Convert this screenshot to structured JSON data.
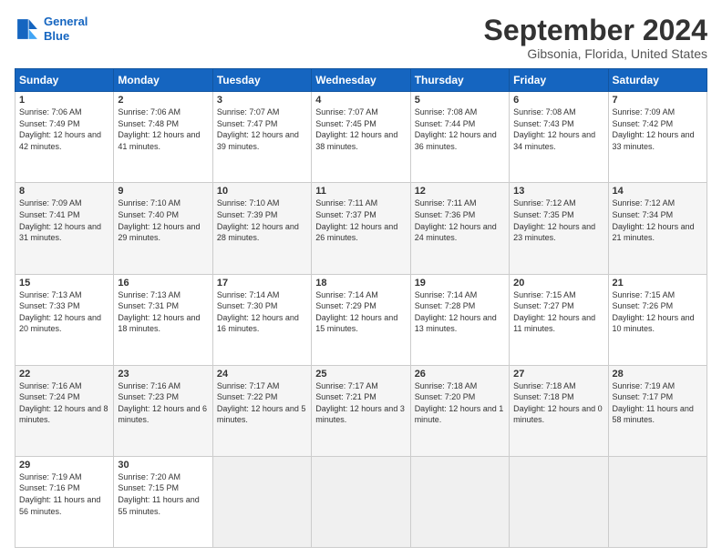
{
  "logo": {
    "line1": "General",
    "line2": "Blue"
  },
  "title": "September 2024",
  "subtitle": "Gibsonia, Florida, United States",
  "headers": [
    "Sunday",
    "Monday",
    "Tuesday",
    "Wednesday",
    "Thursday",
    "Friday",
    "Saturday"
  ],
  "weeks": [
    [
      {
        "day": "1",
        "sunrise": "7:06 AM",
        "sunset": "7:49 PM",
        "daylight": "12 hours and 42 minutes."
      },
      {
        "day": "2",
        "sunrise": "7:06 AM",
        "sunset": "7:48 PM",
        "daylight": "12 hours and 41 minutes."
      },
      {
        "day": "3",
        "sunrise": "7:07 AM",
        "sunset": "7:47 PM",
        "daylight": "12 hours and 39 minutes."
      },
      {
        "day": "4",
        "sunrise": "7:07 AM",
        "sunset": "7:45 PM",
        "daylight": "12 hours and 38 minutes."
      },
      {
        "day": "5",
        "sunrise": "7:08 AM",
        "sunset": "7:44 PM",
        "daylight": "12 hours and 36 minutes."
      },
      {
        "day": "6",
        "sunrise": "7:08 AM",
        "sunset": "7:43 PM",
        "daylight": "12 hours and 34 minutes."
      },
      {
        "day": "7",
        "sunrise": "7:09 AM",
        "sunset": "7:42 PM",
        "daylight": "12 hours and 33 minutes."
      }
    ],
    [
      {
        "day": "8",
        "sunrise": "7:09 AM",
        "sunset": "7:41 PM",
        "daylight": "12 hours and 31 minutes."
      },
      {
        "day": "9",
        "sunrise": "7:10 AM",
        "sunset": "7:40 PM",
        "daylight": "12 hours and 29 minutes."
      },
      {
        "day": "10",
        "sunrise": "7:10 AM",
        "sunset": "7:39 PM",
        "daylight": "12 hours and 28 minutes."
      },
      {
        "day": "11",
        "sunrise": "7:11 AM",
        "sunset": "7:37 PM",
        "daylight": "12 hours and 26 minutes."
      },
      {
        "day": "12",
        "sunrise": "7:11 AM",
        "sunset": "7:36 PM",
        "daylight": "12 hours and 24 minutes."
      },
      {
        "day": "13",
        "sunrise": "7:12 AM",
        "sunset": "7:35 PM",
        "daylight": "12 hours and 23 minutes."
      },
      {
        "day": "14",
        "sunrise": "7:12 AM",
        "sunset": "7:34 PM",
        "daylight": "12 hours and 21 minutes."
      }
    ],
    [
      {
        "day": "15",
        "sunrise": "7:13 AM",
        "sunset": "7:33 PM",
        "daylight": "12 hours and 20 minutes."
      },
      {
        "day": "16",
        "sunrise": "7:13 AM",
        "sunset": "7:31 PM",
        "daylight": "12 hours and 18 minutes."
      },
      {
        "day": "17",
        "sunrise": "7:14 AM",
        "sunset": "7:30 PM",
        "daylight": "12 hours and 16 minutes."
      },
      {
        "day": "18",
        "sunrise": "7:14 AM",
        "sunset": "7:29 PM",
        "daylight": "12 hours and 15 minutes."
      },
      {
        "day": "19",
        "sunrise": "7:14 AM",
        "sunset": "7:28 PM",
        "daylight": "12 hours and 13 minutes."
      },
      {
        "day": "20",
        "sunrise": "7:15 AM",
        "sunset": "7:27 PM",
        "daylight": "12 hours and 11 minutes."
      },
      {
        "day": "21",
        "sunrise": "7:15 AM",
        "sunset": "7:26 PM",
        "daylight": "12 hours and 10 minutes."
      }
    ],
    [
      {
        "day": "22",
        "sunrise": "7:16 AM",
        "sunset": "7:24 PM",
        "daylight": "12 hours and 8 minutes."
      },
      {
        "day": "23",
        "sunrise": "7:16 AM",
        "sunset": "7:23 PM",
        "daylight": "12 hours and 6 minutes."
      },
      {
        "day": "24",
        "sunrise": "7:17 AM",
        "sunset": "7:22 PM",
        "daylight": "12 hours and 5 minutes."
      },
      {
        "day": "25",
        "sunrise": "7:17 AM",
        "sunset": "7:21 PM",
        "daylight": "12 hours and 3 minutes."
      },
      {
        "day": "26",
        "sunrise": "7:18 AM",
        "sunset": "7:20 PM",
        "daylight": "12 hours and 1 minute."
      },
      {
        "day": "27",
        "sunrise": "7:18 AM",
        "sunset": "7:18 PM",
        "daylight": "12 hours and 0 minutes."
      },
      {
        "day": "28",
        "sunrise": "7:19 AM",
        "sunset": "7:17 PM",
        "daylight": "11 hours and 58 minutes."
      }
    ],
    [
      {
        "day": "29",
        "sunrise": "7:19 AM",
        "sunset": "7:16 PM",
        "daylight": "11 hours and 56 minutes."
      },
      {
        "day": "30",
        "sunrise": "7:20 AM",
        "sunset": "7:15 PM",
        "daylight": "11 hours and 55 minutes."
      },
      null,
      null,
      null,
      null,
      null
    ]
  ],
  "labels": {
    "sunrise": "Sunrise:",
    "sunset": "Sunset:",
    "daylight": "Daylight:"
  }
}
